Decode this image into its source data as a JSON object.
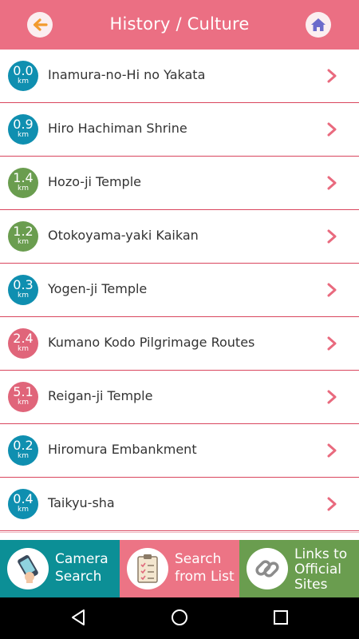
{
  "header": {
    "title": "History / Culture",
    "back_icon": "arrow-left-icon",
    "home_icon": "home-icon",
    "color": "#eb6f83"
  },
  "items": [
    {
      "distance": "0.0",
      "unit": "km",
      "name": "Inamura-no-Hi no Yakata",
      "color": "#0f8fb0"
    },
    {
      "distance": "0.9",
      "unit": "km",
      "name": "Hiro Hachiman Shrine",
      "color": "#0f8fb0"
    },
    {
      "distance": "1.4",
      "unit": "km",
      "name": "Hozo-ji Temple",
      "color": "#6a9d4f"
    },
    {
      "distance": "1.2",
      "unit": "km",
      "name": "Otokoyama-yaki Kaikan",
      "color": "#6a9d4f"
    },
    {
      "distance": "0.3",
      "unit": "km",
      "name": "Yogen-ji Temple",
      "color": "#0f8fb0"
    },
    {
      "distance": "2.4",
      "unit": "km",
      "name": "Kumano Kodo Pilgrimage Routes",
      "color": "#e0657a"
    },
    {
      "distance": "5.1",
      "unit": "km",
      "name": "Reigan-ji Temple",
      "color": "#e0657a"
    },
    {
      "distance": "0.2",
      "unit": "km",
      "name": "Hiromura Embankment",
      "color": "#0f8fb0"
    },
    {
      "distance": "0.4",
      "unit": "km",
      "name": "Taikyu-sha",
      "color": "#0f8fb0"
    }
  ],
  "bottom_tabs": [
    {
      "line1": "Camera",
      "line2": "Search",
      "icon": "camera-phone-icon",
      "color": "#0c8f96"
    },
    {
      "line1": "Search",
      "line2": "from List",
      "icon": "checklist-icon",
      "color": "#ec7485"
    },
    {
      "line1": "Links to",
      "line2": "Official",
      "line3": "Sites",
      "icon": "link-icon",
      "color": "#6a9d4f"
    }
  ],
  "system_nav": {
    "back_icon": "nav-back-icon",
    "home_icon": "nav-home-icon",
    "recents_icon": "nav-recents-icon"
  }
}
